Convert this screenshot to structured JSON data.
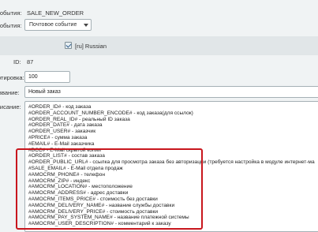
{
  "form": {
    "event_type_label": "события:",
    "event_type_value": "SALE_NEW_ORDER",
    "event_kind_label": "события:",
    "event_kind_value": "Почтовое событие",
    "language_label": "[ru] Russian",
    "id_label": "ID:",
    "id_value": "87",
    "sort_label": "ртировка:",
    "sort_value": "100",
    "name_label": "Название:",
    "name_value": "Новый заказ",
    "description_label": "Описание:",
    "description_lines": [
      "#ORDER_ID# - код заказа",
      "#ORDER_ACCOUNT_NUMBER_ENCODE# - код заказа(для ссылок)",
      "#ORDER_REAL_ID# - реальный ID заказа",
      "#ORDER_DATE# - дата заказа",
      "#ORDER_USER# - заказчик",
      "#PRICE# - сумма заказа",
      "#EMAIL# - E-Mail заказчика",
      "#BCC# - E-Mail скрытой копии",
      "#ORDER_LIST# - состав заказа",
      "#ORDER_PUBLIC_URL# - ссылка для просмотра заказа без авторизации (требуется настройка в модуле интернет-ма",
      "#SALE_EMAIL# - E-Mail отдела продаж",
      "#AMOCRM_PHONE# - телефон",
      "#AMOCRM_ZIP# - индекс",
      "#AMOCRM_LOCATION# - местоположение",
      "#AMOCRM_ADDRESS# - адрес доставки",
      "#AMOCRM_ITEMS_PRICE# - стоимость без доставки",
      "#AMOCRM_DELIVERY_NAME# - название службы доставки",
      "#AMOCRM_DELIVERY_PRICE# - стоимость доставки",
      "#AMOCRM_PAY_SYSTEM_NAME# - название платежной системы",
      "#AMOCRM_USER_DESCRIPTION# - комментарий к заказу"
    ]
  },
  "colors": {
    "highlight": "#c8161d"
  }
}
